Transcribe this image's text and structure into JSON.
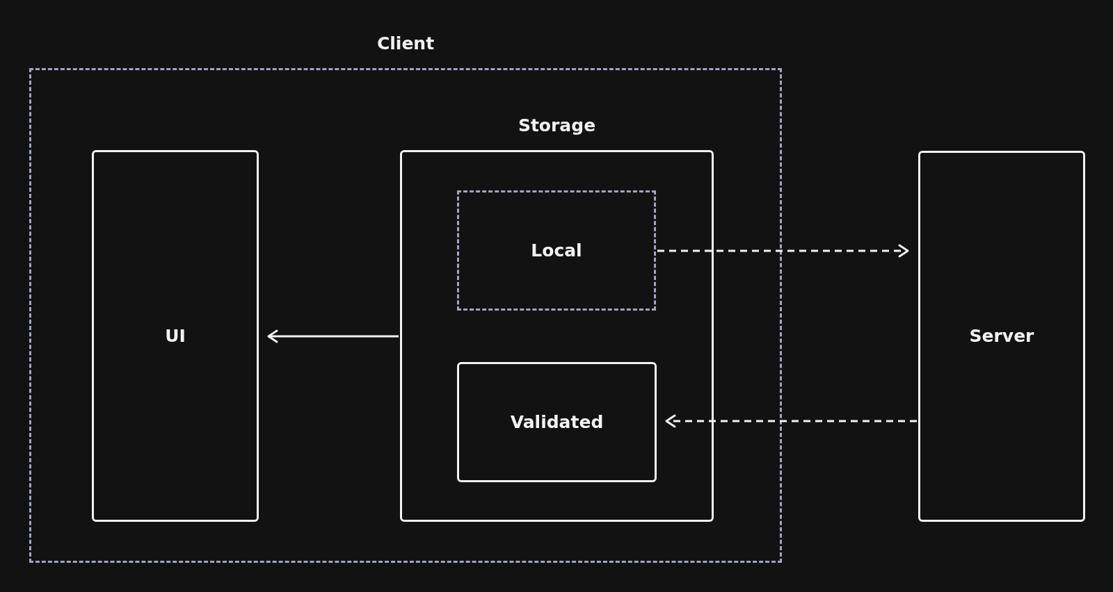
{
  "nodes": [
    {
      "label": "Client",
      "kind": "group"
    },
    {
      "label": "Storage",
      "kind": "container"
    },
    {
      "label": "Local",
      "kind": "zone"
    },
    {
      "label": "Validated",
      "kind": "box"
    },
    {
      "label": "UI",
      "kind": "box"
    },
    {
      "label": "Server",
      "kind": "box"
    }
  ],
  "edges": [
    {
      "kind": "solid"
    },
    {
      "kind": "dashed"
    },
    {
      "kind": "dashed"
    }
  ]
}
